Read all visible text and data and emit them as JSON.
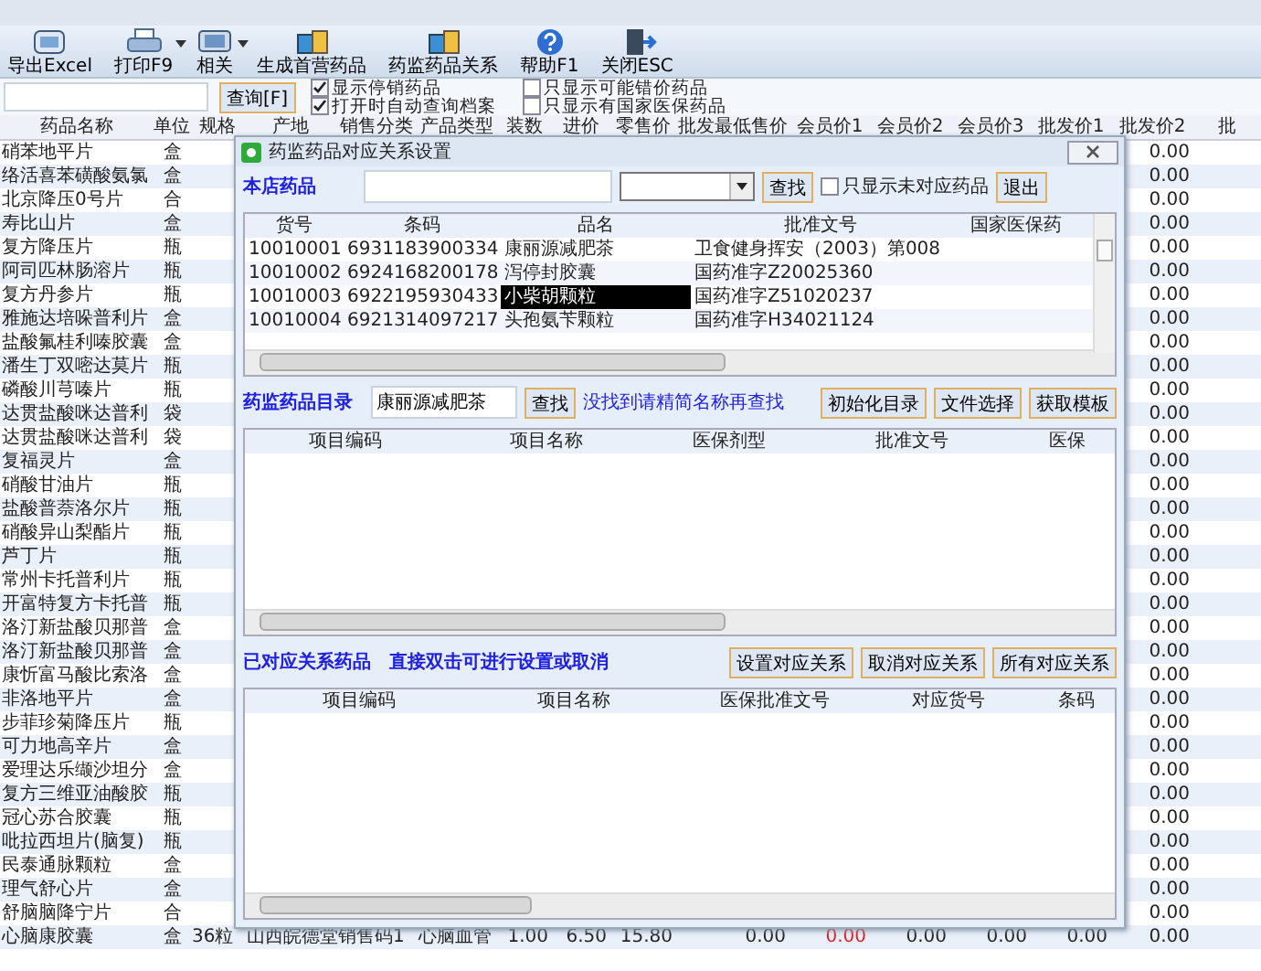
{
  "toolbar": [
    {
      "label": "导出Excel",
      "dropdown": false
    },
    {
      "label": "打印F9",
      "dropdown": true
    },
    {
      "label": "相关",
      "dropdown": true
    },
    {
      "label": "生成首营药品",
      "dropdown": false
    },
    {
      "label": "药监药品关系",
      "dropdown": false
    },
    {
      "label": "帮助F1",
      "dropdown": false
    },
    {
      "label": "关闭ESC",
      "dropdown": false
    }
  ],
  "search": {
    "button": "查询[F]",
    "options": [
      {
        "label": "显示停销药品",
        "checked": true
      },
      {
        "label": "只显示可能错价药品",
        "checked": false
      },
      {
        "label": "打开时自动查询档案",
        "checked": true
      },
      {
        "label": "只显示有国家医保药品",
        "checked": false
      }
    ]
  },
  "table": {
    "columns": [
      "药品名称",
      "单位",
      "规格",
      "产地",
      "销售分类",
      "产品类型",
      "装数",
      "进价",
      "零售价",
      "批发最低售价",
      "会员价1",
      "会员价2",
      "会员价3",
      "批发价1",
      "批发价2",
      "批"
    ],
    "rows": [
      {
        "name": "硝苯地平片",
        "unit": "盒",
        "wholesale_price_2": "0.00"
      },
      {
        "name": "络活喜苯磺酸氨氯",
        "unit": "盒",
        "wholesale_price_2": "0.00"
      },
      {
        "name": "北京降压0号片",
        "unit": "合",
        "wholesale_price_2": "0.00"
      },
      {
        "name": "寿比山片",
        "unit": "盒",
        "wholesale_price_2": "0.00"
      },
      {
        "name": "复方降压片",
        "unit": "瓶",
        "wholesale_price_2": "0.00"
      },
      {
        "name": "阿司匹林肠溶片",
        "unit": "瓶",
        "wholesale_price_2": "0.00"
      },
      {
        "name": "复方丹参片",
        "unit": "瓶",
        "wholesale_price_2": "0.00"
      },
      {
        "name": "雅施达培哚普利片",
        "unit": "盒",
        "wholesale_price_2": "0.00"
      },
      {
        "name": "盐酸氟桂利嗪胶囊",
        "unit": "盒",
        "wholesale_price_2": "0.00"
      },
      {
        "name": "潘生丁双嘧达莫片",
        "unit": "瓶",
        "wholesale_price_2": "0.00"
      },
      {
        "name": "磷酸川芎嗪片",
        "unit": "瓶",
        "wholesale_price_2": "0.00"
      },
      {
        "name": "达贯盐酸咪达普利",
        "unit": "袋",
        "wholesale_price_2": "0.00"
      },
      {
        "name": "达贯盐酸咪达普利",
        "unit": "袋",
        "wholesale_price_2": "0.00"
      },
      {
        "name": "复福灵片",
        "unit": "盒",
        "wholesale_price_2": "0.00"
      },
      {
        "name": "硝酸甘油片",
        "unit": "瓶",
        "wholesale_price_2": "0.00"
      },
      {
        "name": "盐酸普萘洛尔片",
        "unit": "瓶",
        "wholesale_price_2": "0.00"
      },
      {
        "name": "硝酸异山梨酯片",
        "unit": "瓶",
        "wholesale_price_2": "0.00"
      },
      {
        "name": "芦丁片",
        "unit": "瓶",
        "wholesale_price_2": "0.00"
      },
      {
        "name": "常州卡托普利片",
        "unit": "瓶",
        "wholesale_price_2": "0.00"
      },
      {
        "name": "开富特复方卡托普",
        "unit": "瓶",
        "wholesale_price_2": "0.00"
      },
      {
        "name": "洛汀新盐酸贝那普",
        "unit": "盒",
        "wholesale_price_2": "0.00"
      },
      {
        "name": "洛汀新盐酸贝那普",
        "unit": "盒",
        "wholesale_price_2": "0.00"
      },
      {
        "name": "康忻富马酸比索洛",
        "unit": "盒",
        "wholesale_price_2": "0.00"
      },
      {
        "name": "非洛地平片",
        "unit": "盒",
        "wholesale_price_2": "0.00"
      },
      {
        "name": "步菲珍菊降压片",
        "unit": "瓶",
        "wholesale_price_2": "0.00"
      },
      {
        "name": "可力地高辛片",
        "unit": "盒",
        "wholesale_price_2": "0.00"
      },
      {
        "name": "爱理达乐缬沙坦分",
        "unit": "盒",
        "wholesale_price_2": "0.00"
      },
      {
        "name": "复方三维亚油酸胶",
        "unit": "瓶",
        "wholesale_price_2": "0.00"
      },
      {
        "name": "冠心苏合胶囊",
        "unit": "瓶",
        "wholesale_price_2": "0.00"
      },
      {
        "name": "吡拉西坦片(脑复)",
        "unit": "瓶",
        "wholesale_price_2": "0.00"
      },
      {
        "name": "民泰通脉颗粒",
        "unit": "盒",
        "wholesale_price_2": "0.00"
      },
      {
        "name": "理气舒心片",
        "unit": "盒",
        "wholesale_price_2": "0.00"
      },
      {
        "name": "舒脑脑降宁片",
        "unit": "合",
        "wholesale_price_2": "0.00"
      },
      {
        "name": "心脑康胶囊",
        "unit": "盒",
        "wholesale_price_2": "0.00",
        "spec": "36粒",
        "origin": "山西皖德堂",
        "sales_class": "销售码1",
        "product_type": "心脑血管",
        "prices": [
          {
            "text": "1.00",
            "warn": false
          },
          {
            "text": "6.50",
            "warn": false
          },
          {
            "text": "15.80",
            "warn": false
          },
          {
            "text": "0.00",
            "warn": false
          },
          {
            "text": "0.00",
            "warn": true
          },
          {
            "text": "0.00",
            "warn": false
          },
          {
            "text": "0.00",
            "warn": false
          },
          {
            "text": "0.00",
            "warn": false
          }
        ]
      }
    ]
  },
  "dialog": {
    "title": "药监药品对应关系设置",
    "store": {
      "label": "本店药品",
      "find_button": "查找",
      "filter": {
        "label": "只显示未对应药品",
        "checked": false
      },
      "exit_button": "退出",
      "columns": [
        "货号",
        "条码",
        "品名",
        "批准文号",
        "国家医保药"
      ],
      "rows": [
        {
          "code": "10010001",
          "barcode": "6931183900334",
          "name": "康丽源减肥茶",
          "approval": "卫食健身挥安（2003）第008",
          "selected": false
        },
        {
          "code": "10010002",
          "barcode": "6924168200178",
          "name": "泻停封胶囊",
          "approval": "国药准字Z20025360",
          "selected": false
        },
        {
          "code": "10010003",
          "barcode": "6922195930433",
          "name": "小柴胡颗粒",
          "approval": "国药准字Z51020237",
          "selected": true
        },
        {
          "code": "10010004",
          "barcode": "6921314097217",
          "name": "头孢氨苄颗粒",
          "approval": "国药准字H34021124",
          "selected": false
        }
      ]
    },
    "catalog": {
      "label": "药监药品目录",
      "query": "康丽源减肥茶",
      "find_button": "查找",
      "hint": "没找到请精简名称再查找",
      "buttons": [
        "初始化目录",
        "文件选择",
        "获取模板"
      ],
      "columns": [
        "项目编码",
        "项目名称",
        "医保剂型",
        "批准文号",
        "医保"
      ]
    },
    "mapped": {
      "label": "已对应关系药品",
      "hint": "直接双击可进行设置或取消",
      "buttons": [
        "设置对应关系",
        "取消对应关系",
        "所有对应关系"
      ],
      "columns": [
        "项目编码",
        "项目名称",
        "医保批准文号",
        "对应货号",
        "条码"
      ]
    }
  }
}
